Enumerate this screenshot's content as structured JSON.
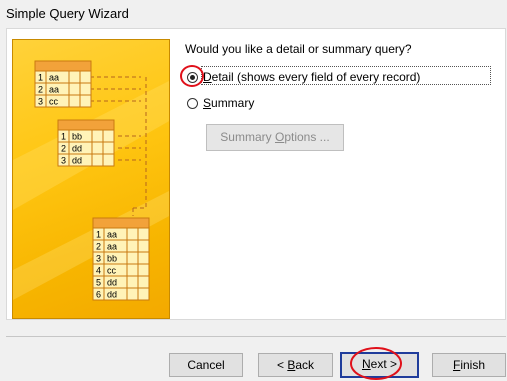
{
  "window": {
    "title": "Simple Query Wizard"
  },
  "illustration": {
    "table1": [
      [
        "1",
        "aa"
      ],
      [
        "2",
        "aa"
      ],
      [
        "3",
        "cc"
      ]
    ],
    "table2": [
      [
        "1",
        "bb"
      ],
      [
        "2",
        "dd"
      ],
      [
        "3",
        "dd"
      ]
    ],
    "table3": [
      [
        "1",
        "aa"
      ],
      [
        "2",
        "aa"
      ],
      [
        "3",
        "bb"
      ],
      [
        "4",
        "cc"
      ],
      [
        "5",
        "dd"
      ],
      [
        "6",
        "dd"
      ]
    ]
  },
  "main": {
    "question": "Would you like a detail or summary query?",
    "options": [
      {
        "accel": "D",
        "rest": "etail (shows every field of every record)",
        "selected": true
      },
      {
        "accel": "S",
        "rest": "ummary",
        "selected": false
      }
    ],
    "summary_options": {
      "pre": "Summary ",
      "accel": "O",
      "post": "ptions ..."
    }
  },
  "buttons": {
    "cancel": "Cancel",
    "back": {
      "pre": "< ",
      "accel": "B",
      "post": "ack"
    },
    "next": {
      "accel": "N",
      "post": "ext >"
    },
    "finish": {
      "accel": "F",
      "post": "inish"
    }
  },
  "colors": {
    "highlight_ring": "#e0101a",
    "default_button_border": "#1f3c9b"
  }
}
